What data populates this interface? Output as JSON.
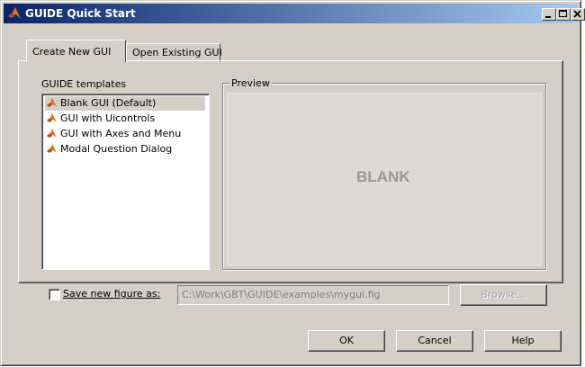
{
  "window": {
    "title": "GUIDE Quick Start",
    "title_bar_colors": [
      "#0a246a",
      "#a6caf0"
    ]
  },
  "tabs": [
    {
      "label": "Create New GUI",
      "active": true
    },
    {
      "label": "Open Existing GUI",
      "active": false
    }
  ],
  "templates": {
    "heading": "GUIDE templates",
    "items": [
      {
        "label": "Blank GUI (Default)",
        "selected": true,
        "icon": "matlab-icon"
      },
      {
        "label": "GUI with Uicontrols",
        "selected": false,
        "icon": "matlab-icon"
      },
      {
        "label": "GUI with Axes and Menu",
        "selected": false,
        "icon": "matlab-icon"
      },
      {
        "label": "Modal Question Dialog",
        "selected": false,
        "icon": "matlab-icon"
      }
    ]
  },
  "preview": {
    "legend": "Preview",
    "text": "BLANK"
  },
  "save": {
    "checked": false,
    "label": "Save new figure as:",
    "path": "C:\\Work\\GBT\\GUIDE\\examples\\mygui.fig",
    "browse_label": "Browse..."
  },
  "buttons": {
    "ok": "OK",
    "cancel": "Cancel",
    "help": "Help"
  }
}
